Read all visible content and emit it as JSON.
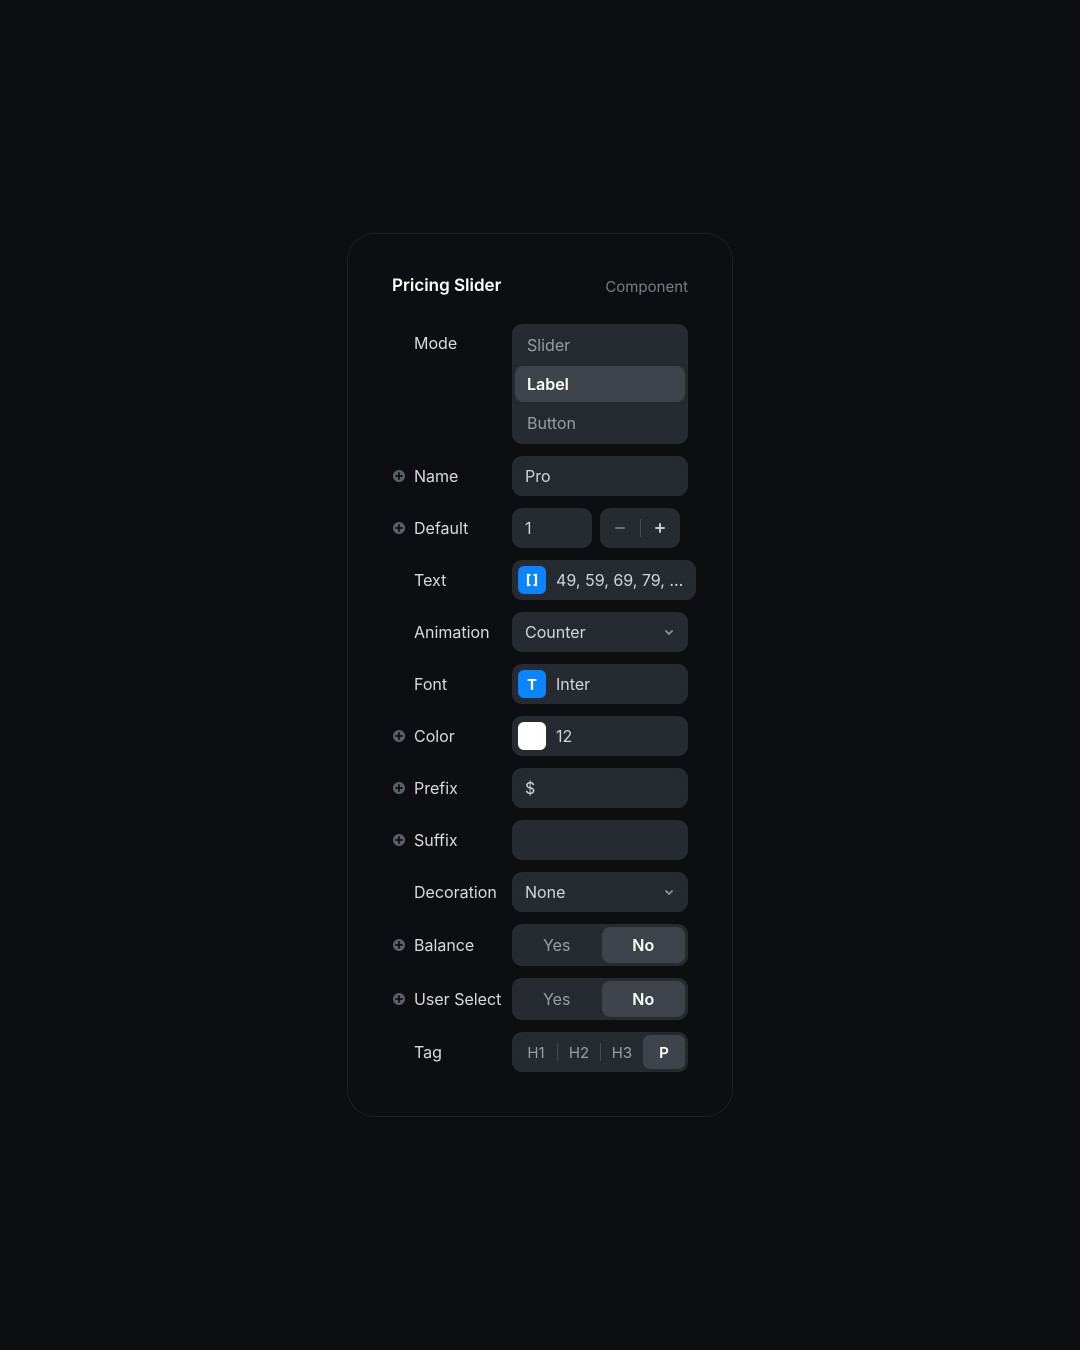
{
  "panel": {
    "title": "Pricing Slider",
    "type": "Component"
  },
  "fields": {
    "mode": {
      "label": "Mode",
      "options": [
        "Slider",
        "Label",
        "Button"
      ],
      "selected": "Label"
    },
    "name": {
      "label": "Name",
      "value": "Pro"
    },
    "default": {
      "label": "Default",
      "value": "1"
    },
    "text": {
      "label": "Text",
      "value": "49, 59, 69, 79, ...",
      "tag_letter": "[ ]"
    },
    "animation": {
      "label": "Animation",
      "value": "Counter"
    },
    "font": {
      "label": "Font",
      "value": "Inter",
      "tag_letter": "T"
    },
    "color": {
      "label": "Color",
      "value": "12",
      "swatch": "#ffffff"
    },
    "prefix": {
      "label": "Prefix",
      "value": "$"
    },
    "suffix": {
      "label": "Suffix",
      "value": ""
    },
    "decoration": {
      "label": "Decoration",
      "value": "None"
    },
    "balance": {
      "label": "Balance",
      "options": [
        "Yes",
        "No"
      ],
      "selected": "No"
    },
    "user_select": {
      "label": "User Select",
      "options": [
        "Yes",
        "No"
      ],
      "selected": "No"
    },
    "tag": {
      "label": "Tag",
      "options": [
        "H1",
        "H2",
        "H3",
        "P"
      ],
      "selected": "P"
    }
  }
}
